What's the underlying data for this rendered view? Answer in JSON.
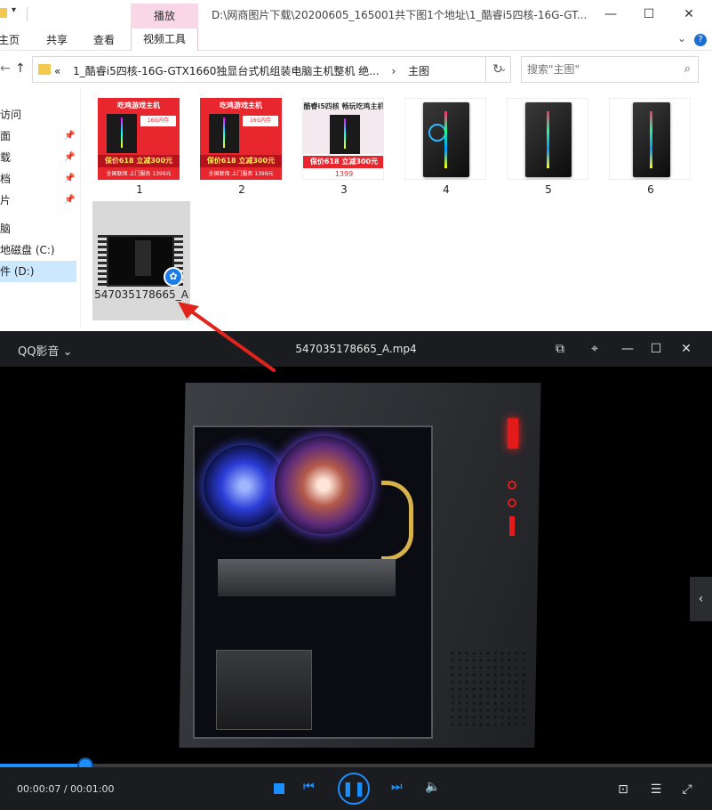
{
  "explorer": {
    "title_path": "D:\\网商图片下载\\20200605_165001共下图1个地址\\1_酷睿i5四核-16G-GT...",
    "ribbon_tabs": [
      "主页",
      "共享",
      "查看"
    ],
    "context_tab_group": "播放",
    "context_tab": "视频工具",
    "address_segments": [
      "«",
      "1_酷睿i5四核-16G-GTX1660独显台式机组装电脑主机整机 绝...",
      "›",
      "主图"
    ],
    "search_placeholder": "搜索\"主图\"",
    "sidebar": [
      {
        "label": "访问",
        "pinned": false
      },
      {
        "label": "面",
        "pinned": true
      },
      {
        "label": "载",
        "pinned": true
      },
      {
        "label": "档",
        "pinned": true
      },
      {
        "label": "片",
        "pinned": true
      },
      {
        "label": "脑",
        "pinned": false
      },
      {
        "label": "地磁盘 (C:)",
        "pinned": false
      },
      {
        "label": "件 (D:)",
        "pinned": false,
        "active": true
      }
    ],
    "files": [
      {
        "name": "1",
        "kind": "poster",
        "header": "吃鸡游戏主机",
        "badge": "16G内存",
        "price": "保价618 立减300元",
        "foot": "全国联保 上门服务 1399元"
      },
      {
        "name": "2",
        "kind": "poster",
        "header": "吃鸡游戏主机",
        "badge": "16G内存",
        "price": "保价618 立减300元",
        "foot": "全国联保 上门服务 1399元"
      },
      {
        "name": "3",
        "kind": "poster-white",
        "header": "酷睿i5四核 畅玩吃鸡主机",
        "price": "保价618 立减300元",
        "foot": "1399"
      },
      {
        "name": "4",
        "kind": "case"
      },
      {
        "name": "5",
        "kind": "case"
      },
      {
        "name": "6",
        "kind": "case"
      },
      {
        "name": "547035178665_A",
        "kind": "video"
      }
    ]
  },
  "player": {
    "app_name": "QQ影音",
    "file_title": "547035178665_A.mp4",
    "current_time": "00:00:07",
    "duration": "00:01:00",
    "time_display": "00:00:07 / 00:01:00",
    "progress": 0.12,
    "accent_color": "#1b8fff"
  }
}
